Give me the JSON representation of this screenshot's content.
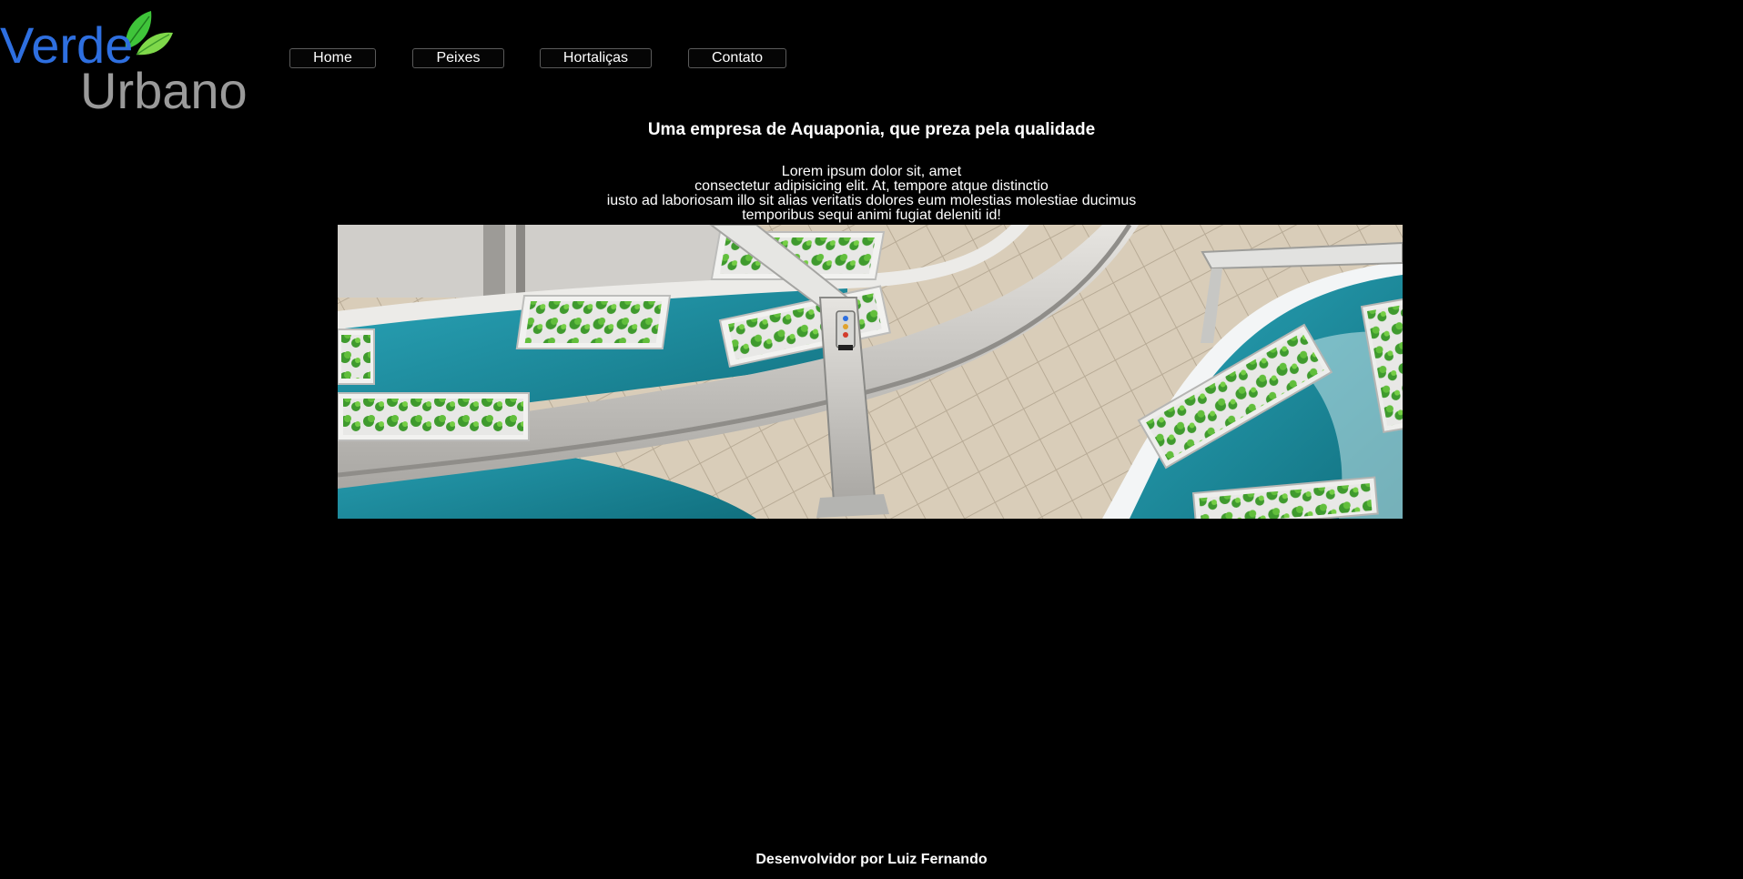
{
  "logo": {
    "word1": "Verde",
    "word2": "Urbano",
    "color_word1": "#2e6fe0",
    "color_word2": "#9a9a9a",
    "icon": "leaf-icon"
  },
  "nav": {
    "items": [
      {
        "label": "Home"
      },
      {
        "label": "Peixes"
      },
      {
        "label": "Hortaliças"
      },
      {
        "label": "Contato"
      }
    ]
  },
  "main": {
    "headline": "Uma empresa de Aquaponia, que preza pela qualidade",
    "intro_lines": [
      "Lorem ipsum dolor sit, amet",
      "consectetur adipisicing elit. At, tempore atque distinctio",
      "iusto ad laboriosam illo sit alias veritatis dolores eum molestias molestiae ducimus",
      "temporibus sequi animi fugiat deleniti id!"
    ]
  },
  "footer": {
    "credit": "Desenvolvidor por Luiz Fernando"
  },
  "colors": {
    "background": "#000000",
    "text": "#ffffff",
    "water": "#1f8fa3"
  }
}
